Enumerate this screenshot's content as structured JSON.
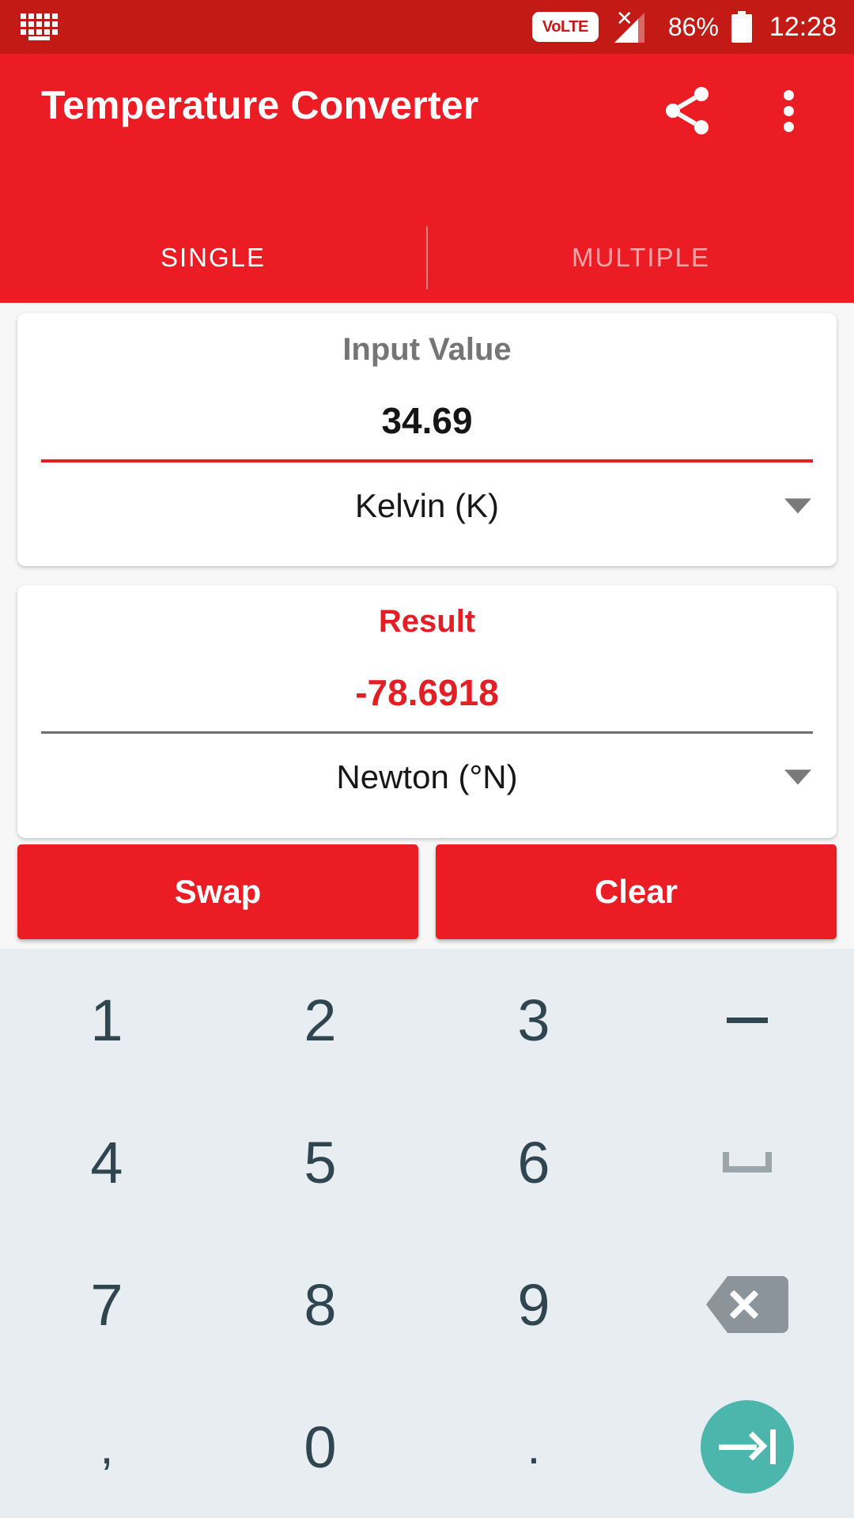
{
  "status_bar": {
    "keyboard_icon": "keyboard-icon",
    "volte_label": "VoLTE",
    "signal_icon": "no-signal-icon",
    "battery_percent": "86%",
    "battery_icon": "battery-icon",
    "time": "12:28"
  },
  "app_bar": {
    "title": "Temperature Converter",
    "share_icon": "share-icon",
    "overflow_icon": "overflow-menu-icon",
    "background_color": "#EC1C24"
  },
  "tabs": [
    {
      "label": "SINGLE",
      "active": true
    },
    {
      "label": "MULTIPLE",
      "active": false
    }
  ],
  "input_card": {
    "label": "Input Value",
    "value": "34.69",
    "unit": "Kelvin (K)",
    "underline_color": "#E31E24",
    "dropdown_icon": "chevron-down-icon"
  },
  "result_card": {
    "label": "Result",
    "value": "-78.6918",
    "unit": "Newton (°N)",
    "label_color": "#E31E24",
    "underline_color": "#6E6E6E",
    "dropdown_icon": "chevron-down-icon"
  },
  "actions": {
    "swap_label": "Swap",
    "clear_label": "Clear",
    "button_color": "#EC1C24"
  },
  "keyboard": {
    "background_color": "#E8EDF1",
    "key_color": "#2F4550",
    "enter_color": "#4DB6AC",
    "backspace_color": "#8A949A",
    "rows": [
      [
        {
          "label": "1",
          "name": "key-1",
          "type": "text"
        },
        {
          "label": "2",
          "name": "key-2",
          "type": "text"
        },
        {
          "label": "3",
          "name": "key-3",
          "type": "text"
        },
        {
          "label": "",
          "name": "key-minus",
          "type": "minus"
        }
      ],
      [
        {
          "label": "4",
          "name": "key-4",
          "type": "text"
        },
        {
          "label": "5",
          "name": "key-5",
          "type": "text"
        },
        {
          "label": "6",
          "name": "key-6",
          "type": "text"
        },
        {
          "label": "",
          "name": "key-space",
          "type": "space"
        }
      ],
      [
        {
          "label": "7",
          "name": "key-7",
          "type": "text"
        },
        {
          "label": "8",
          "name": "key-8",
          "type": "text"
        },
        {
          "label": "9",
          "name": "key-9",
          "type": "text"
        },
        {
          "label": "",
          "name": "key-backspace",
          "type": "backspace"
        }
      ],
      [
        {
          "label": ",",
          "name": "key-comma",
          "type": "text"
        },
        {
          "label": "0",
          "name": "key-0",
          "type": "text"
        },
        {
          "label": ".",
          "name": "key-period",
          "type": "text"
        },
        {
          "label": "",
          "name": "key-enter",
          "type": "enter"
        }
      ]
    ]
  }
}
